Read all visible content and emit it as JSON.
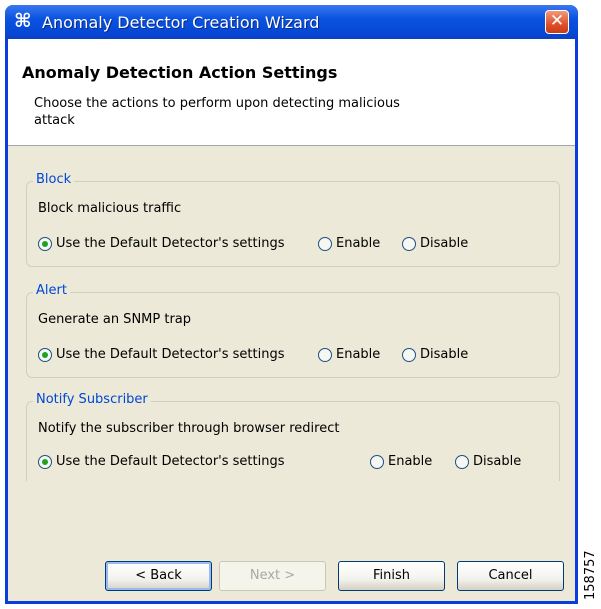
{
  "window": {
    "title": "Anomaly Detector Creation Wizard",
    "icon": "wizard-icon",
    "close_icon": "close-icon"
  },
  "header": {
    "title": "Anomaly Detection Action Settings",
    "description": "Choose the actions to perform upon detecting malicious attack"
  },
  "groups": [
    {
      "label": "Block",
      "description": "Block malicious traffic",
      "options": [
        "Use the Default Detector's settings",
        "Enable",
        "Disable"
      ],
      "selected": 0
    },
    {
      "label": "Alert",
      "description": "Generate an SNMP trap",
      "options": [
        "Use the Default Detector's settings",
        "Enable",
        "Disable"
      ],
      "selected": 0
    },
    {
      "label": "Notify Subscriber",
      "description": "Notify the subscriber through browser redirect",
      "options": [
        "Use the Default Detector's settings",
        "Enable",
        "Disable"
      ],
      "selected": 0
    }
  ],
  "buttons": {
    "back": "< Back",
    "next": "Next >",
    "finish": "Finish",
    "cancel": "Cancel"
  },
  "figure_number": "158757",
  "colors": {
    "titlebar": "#0a53e0",
    "group_label": "#0046d5",
    "dialog_background": "#ece9d8",
    "radio_selected": "#21a121"
  }
}
